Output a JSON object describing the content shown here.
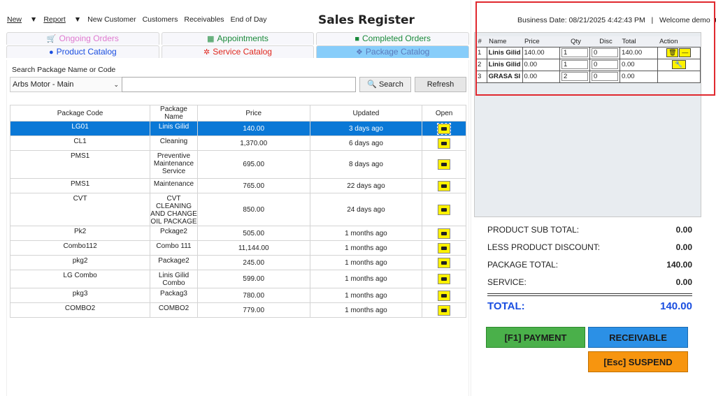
{
  "menu": {
    "new": "New",
    "report": "Report",
    "new_customer": "New Customer",
    "customers": "Customers",
    "receivables": "Receivables",
    "end_of_day": "End of Day"
  },
  "title": "Sales Register",
  "tabs": {
    "ongoing": "Ongoing Orders",
    "appointments": "Appointments",
    "completed": "Completed Orders",
    "product": "Product Catalog",
    "service": "Service Catalog",
    "package": "Package Catalog"
  },
  "search": {
    "label": "Search Package Name or Code",
    "branch": "Arbs Motor - Main",
    "search_btn": "Search",
    "refresh_btn": "Refresh"
  },
  "grid": {
    "headers": [
      "Package Code",
      "Package Name",
      "Price",
      "Updated",
      "Open"
    ],
    "rows": [
      {
        "code": "LG01",
        "name": "Linis Gilid",
        "price": "140.00",
        "updated": "3 days ago"
      },
      {
        "code": "CL1",
        "name": "Cleaning",
        "price": "1,370.00",
        "updated": "6 days ago"
      },
      {
        "code": "PMS1",
        "name": "Preventive Maintenance Service",
        "price": "695.00",
        "updated": "8 days ago"
      },
      {
        "code": "PMS1",
        "name": "Maintenance",
        "price": "765.00",
        "updated": "22 days ago"
      },
      {
        "code": "CVT",
        "name": "CVT CLEANING AND CHANGE OIL PACKAGE",
        "price": "850.00",
        "updated": "24 days ago"
      },
      {
        "code": "Pk2",
        "name": "Pckage2",
        "price": "505.00",
        "updated": "1 months ago"
      },
      {
        "code": "Combo112",
        "name": "Combo 111",
        "price": "11,144.00",
        "updated": "1 months ago"
      },
      {
        "code": "pkg2",
        "name": "Package2",
        "price": "245.00",
        "updated": "1 months ago"
      },
      {
        "code": "LG Combo",
        "name": "Linis Gilid Combo",
        "price": "599.00",
        "updated": "1 months ago"
      },
      {
        "code": "pkg3",
        "name": "Packag3",
        "price": "780.00",
        "updated": "1 months ago"
      },
      {
        "code": "COMBO2",
        "name": "COMBO2",
        "price": "779.00",
        "updated": "1 months ago"
      }
    ]
  },
  "header": {
    "business_date": "Business Date: 08/21/2025 4:42:43 PM",
    "separator": "|",
    "welcome": "Welcome demo"
  },
  "cart": {
    "headers": [
      "#",
      "Name",
      "Price",
      "Qty",
      "Disc",
      "Total",
      "Action"
    ],
    "rows": [
      {
        "num": "1",
        "name": "Linis Gilid",
        "price": "140.00",
        "qty": "1",
        "disc": "0",
        "total": "140.00"
      },
      {
        "num": "2",
        "name": "Linis Gilid",
        "price": "0.00",
        "qty": "1",
        "disc": "0",
        "total": "0.00"
      },
      {
        "num": "3",
        "name": "GRASA SI",
        "price": "0.00",
        "qty": "2",
        "disc": "0",
        "total": "0.00"
      }
    ]
  },
  "totals": {
    "product_sub_label": "PRODUCT SUB TOTAL:",
    "product_sub": "0.00",
    "less_disc_label": "LESS PRODUCT DISCOUNT:",
    "less_disc": "0.00",
    "package_label": "PACKAGE TOTAL:",
    "package": "140.00",
    "service_label": "SERVICE:",
    "service": "0.00",
    "total_label": "TOTAL:",
    "total": "140.00"
  },
  "buttons": {
    "payment": "[F1] PAYMENT",
    "receivable": "RECEIVABLE",
    "suspend": "[Esc] SUSPEND"
  },
  "colors": {
    "selected_row": "#0a78d6",
    "highlight_box": "#e0282e",
    "payment": "#4ab04a",
    "receivable": "#2b90e6",
    "suspend": "#f7950f",
    "total_text": "#1a4ee0"
  }
}
